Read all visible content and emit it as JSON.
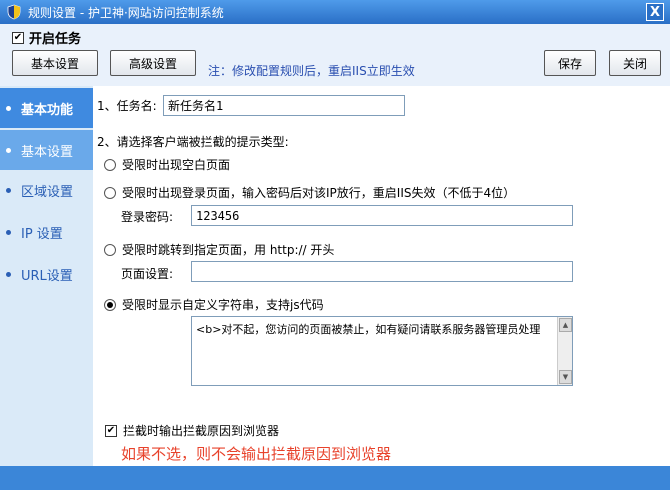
{
  "window": {
    "title": "规则设置 - 护卫神·网站访问控制系统",
    "close_label": "X"
  },
  "toolbar": {
    "enable_task_label": "开启任务",
    "enable_task_checked": true,
    "basic_settings_button": "基本设置",
    "advanced_settings_button": "高级设置",
    "tip": "注：修改配置规则后，重启IIS立即生效",
    "save_button": "保存",
    "close_button": "关闭"
  },
  "sidebar": {
    "items": [
      {
        "label": "基本功能",
        "state": "header"
      },
      {
        "label": "基本设置",
        "state": "selected"
      },
      {
        "label": "区域设置",
        "state": "normal"
      },
      {
        "label": "IP 设置",
        "state": "normal"
      },
      {
        "label": "URL设置",
        "state": "normal"
      }
    ]
  },
  "form": {
    "task_name_label": "1、任务名:",
    "task_name_value": "新任务名1",
    "prompt_type_label": "2、请选择客户端被拦截的提示类型:",
    "options": [
      {
        "label": "受限时出现空白页面",
        "selected": false
      },
      {
        "label": "受限时出现登录页面，输入密码后对该IP放行，重启IIS失效（不低于4位）",
        "selected": false
      },
      {
        "label": "受限时跳转到指定页面，用 http:// 开头",
        "selected": false
      },
      {
        "label": "受限时显示自定义字符串，支持js代码",
        "selected": true
      }
    ],
    "login_password_label": "登录密码:",
    "login_password_value": "123456",
    "page_setting_label": "页面设置:",
    "page_setting_value": "",
    "custom_string_value": "<b>对不起，您访问的页面被禁止，如有疑问请联系服务器管理员处理",
    "output_reason_label": "拦截时输出拦截原因到浏览器",
    "output_reason_checked": true,
    "warning_text": "如果不选，则不会输出拦截原因到浏览器"
  },
  "colors": {
    "title_bar": "#2a6fc6",
    "sidebar_bg": "#daeaf8",
    "sidebar_active": "#3f8ae0",
    "tip_text": "#2a4fb0",
    "warning_text": "#e8432c"
  }
}
